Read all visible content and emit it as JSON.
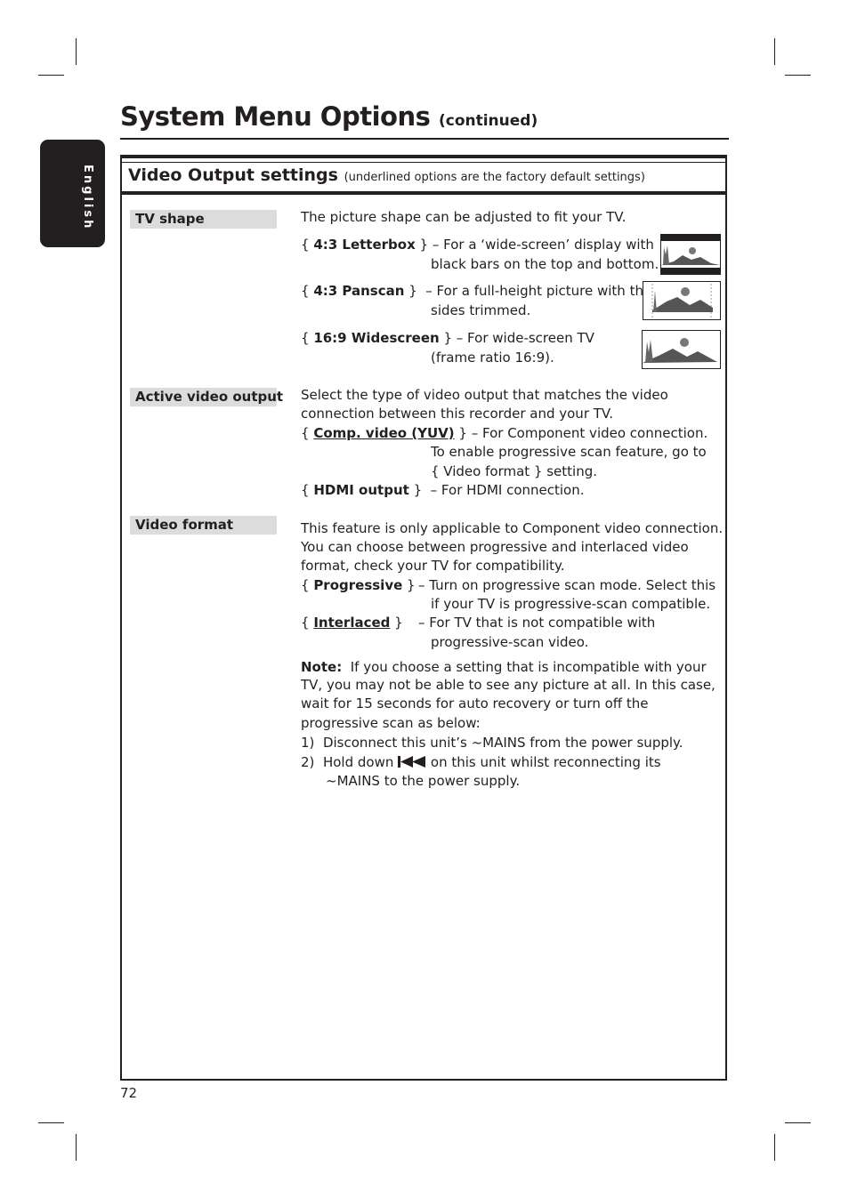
{
  "page": {
    "title": "System Menu Options",
    "title_suffix": "(continued)",
    "language_tab": "English",
    "page_number": "72"
  },
  "section": {
    "heading": "Video Output settings",
    "heading_note": "(underlined options are the factory default settings)"
  },
  "tv_shape": {
    "label": "TV shape",
    "intro": "The picture shape can be adjusted to fit your TV.",
    "options": [
      {
        "name": "4:3 Letterbox",
        "default": false,
        "desc_line1": "– For a ‘wide-screen’ display with",
        "desc_line2": "black bars on the top and bottom.",
        "icon": "letterbox-picture-icon"
      },
      {
        "name": "4:3 Panscan",
        "default": false,
        "desc_line1": "– For a full-height picture with the",
        "desc_line2": "sides trimmed.",
        "icon": "panscan-picture-icon"
      },
      {
        "name": "16:9 Widescreen",
        "default": false,
        "desc_line1": "– For wide-screen TV",
        "desc_line2": "(frame ratio 16:9).",
        "icon": "widescreen-picture-icon"
      }
    ]
  },
  "active_video_output": {
    "label": "Active video output",
    "intro_line1": "Select the type of video output that matches the video",
    "intro_line2": "connection between this recorder and your TV.",
    "options": [
      {
        "name": "Comp. video (YUV)",
        "default": true,
        "desc_line1": "– For Component video connection.",
        "desc_line2": "To enable progressive scan feature, go to",
        "desc_line3": "{ Video format } setting."
      },
      {
        "name": "HDMI output",
        "default": false,
        "desc_line1": "– For HDMI connection."
      }
    ]
  },
  "video_format": {
    "label": "Video format",
    "intro_line1": "This feature is only applicable to Component video connection.",
    "intro_line2": "You can choose between progressive and interlaced video",
    "intro_line3": "format, check your TV for compatibility.",
    "options": [
      {
        "name": "Progressive",
        "default": false,
        "desc_line1": "– Turn on progressive scan mode.  Select this",
        "desc_line2": "if your TV is progressive-scan compatible."
      },
      {
        "name": "Interlaced",
        "default": true,
        "desc_line1": "– For TV that is not compatible with",
        "desc_line2": "progressive-scan video."
      }
    ],
    "note_label": "Note:",
    "note_line1": "If you choose a setting that is incompatible with your",
    "note_line2": "TV, you may not be able to see any picture at all.  In this case,",
    "note_line3": "wait for 15 seconds for auto recovery or turn off the",
    "note_line4": "progressive scan as below:",
    "steps": [
      {
        "num": "1)",
        "text": "Disconnect this unit’s ~MAINS from the power supply."
      },
      {
        "num": "2)",
        "text_before": "Hold down",
        "icon": "previous-track-icon",
        "text_after": "on this unit whilst reconnecting its",
        "text_line2": "~MAINS to the power supply."
      }
    ]
  }
}
